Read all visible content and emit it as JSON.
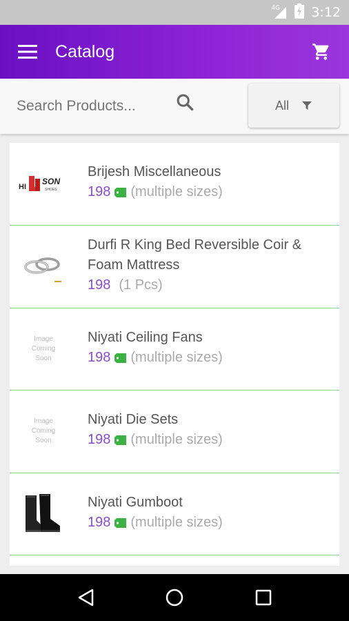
{
  "status": {
    "network": "4G",
    "time": "3:12"
  },
  "app_bar": {
    "title": "Catalog"
  },
  "search": {
    "placeholder": "Search Products..."
  },
  "filter": {
    "label": "All"
  },
  "products": [
    {
      "name": "Brijesh Miscellaneous",
      "price": "198",
      "size": "(multiple sizes)",
      "has_tag": true,
      "thumb": "hillson-logo",
      "logo_text": "HILLSON"
    },
    {
      "name": "Durfi R King Bed Reversible Coir & Foam Mattress",
      "price": "198",
      "size": "(1 Pcs)",
      "has_tag": false,
      "thumb": "rings"
    },
    {
      "name": "Niyati Ceiling Fans",
      "price": "198",
      "size": "(multiple sizes)",
      "has_tag": true,
      "thumb": "placeholder",
      "placeholder_text": [
        "Image",
        "Coming",
        "Soon"
      ]
    },
    {
      "name": "Niyati Die Sets",
      "price": "198",
      "size": "(multiple sizes)",
      "has_tag": true,
      "thumb": "placeholder",
      "placeholder_text": [
        "Image",
        "Coming",
        "Soon"
      ]
    },
    {
      "name": "Niyati Gumboot",
      "price": "198",
      "size": "(multiple sizes)",
      "has_tag": true,
      "thumb": "gumboot"
    }
  ],
  "colors": {
    "app_bar_start": "#6a10c2",
    "app_bar_end": "#9a36dc",
    "price": "#8b4dc9",
    "tag": "#3cb043",
    "divider": "#8fd48f"
  },
  "icons": {
    "menu": "menu-icon",
    "cart": "cart-icon",
    "search": "search-icon",
    "filter": "filter-icon",
    "tag": "tag-icon",
    "back": "back-icon",
    "home": "home-icon",
    "recents": "recents-icon"
  }
}
